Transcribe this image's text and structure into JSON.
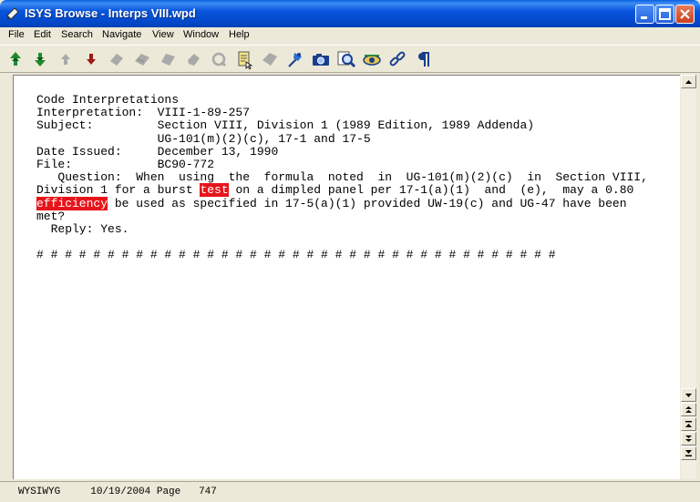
{
  "window": {
    "title": "ISYS Browse - Interps VIII.wpd"
  },
  "menu": [
    "File",
    "Edit",
    "Search",
    "Navigate",
    "View",
    "Window",
    "Help"
  ],
  "toolbar": {
    "buttons": [
      "first-hit-up-icon",
      "next-hit-down-icon",
      "previous-up-icon",
      "next-down-icon",
      "eraser-icon",
      "eraser2-icon",
      "eraser3-icon",
      "eraser4-icon",
      "highlight-icon",
      "notepad-icon",
      "tag-icon",
      "pin-icon",
      "camera-icon",
      "magnify-icon",
      "view-eye-icon",
      "link-icon",
      "pilcrow-icon"
    ]
  },
  "document": {
    "lines": [
      "Code Interpretations",
      "Interpretation:  VIII-1-89-257",
      "Subject:         Section VIII, Division 1 (1989 Edition, 1989 Addenda)",
      "                 UG-101(m)(2)(c), 17-1 and 17-5",
      "Date Issued:     December 13, 1990",
      "File:            BC90-772",
      "   Question:  When  using  the  formula  noted  in  UG-101(m)(2)(c)  in  Section VIII,"
    ],
    "line8_before": "Division 1 for a burst ",
    "hit1": "test",
    "line8_after": " on a dimpled panel per 17-1(a)(1)  and  (e),  may a 0.80",
    "hit2": "efficiency",
    "line9_after": " be used as specified in 17-5(a)(1) provided UW-19(c) and UG-47 have been",
    "line10": "met?",
    "line11": "  Reply: Yes.",
    "separator": "# # # # # # # # # # # # # # # # # # # # # # # # # # # # # # # # # # # # #"
  },
  "status": {
    "mode": "WYSIWYG",
    "date": "10/19/2004",
    "page_label": "Page",
    "page": "747"
  }
}
